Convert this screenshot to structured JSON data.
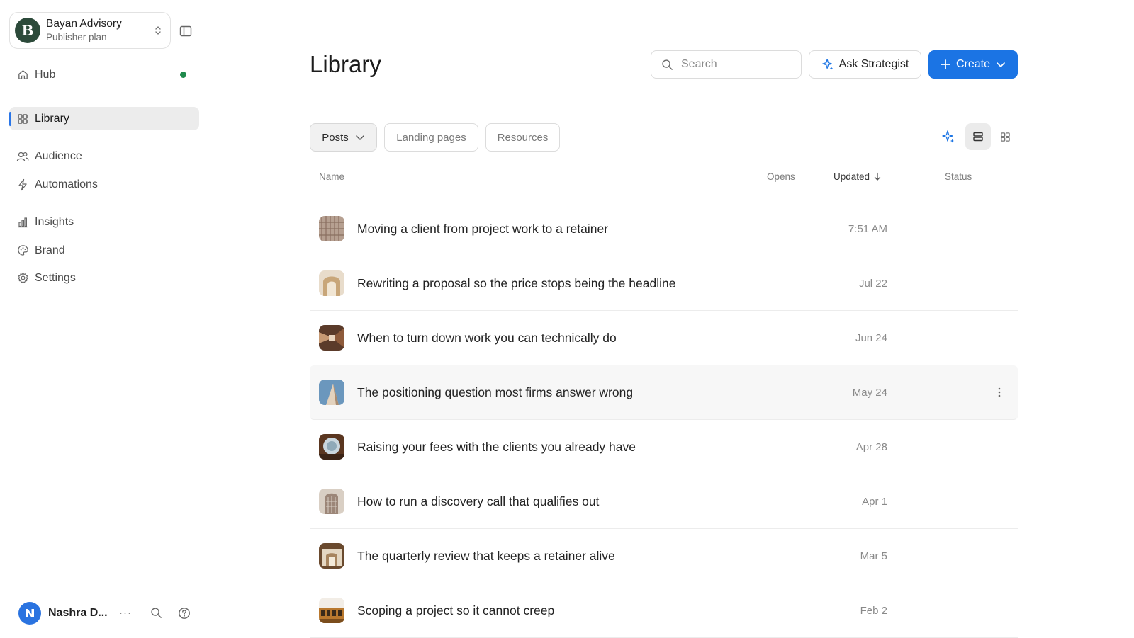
{
  "workspace": {
    "initial": "B",
    "name": "Bayan Advisory",
    "plan": "Publisher plan"
  },
  "nav": {
    "hub": "Hub",
    "library": "Library",
    "audience": "Audience",
    "automations": "Automations",
    "insights": "Insights",
    "brand": "Brand",
    "settings": "Settings"
  },
  "user": {
    "name": "Nashra D...",
    "more": "···"
  },
  "header": {
    "title": "Library",
    "search_placeholder": "Search",
    "ask_label": "Ask Strategist",
    "create_label": "Create"
  },
  "tabs": {
    "posts": "Posts",
    "landing": "Landing pages",
    "resources": "Resources"
  },
  "table": {
    "columns": {
      "name": "Name",
      "opens": "Opens",
      "updated": "Updated",
      "status": "Status"
    },
    "rows": [
      {
        "title": "Moving a client from project work to a retainer",
        "updated": "7:51 AM"
      },
      {
        "title": "Rewriting a proposal so the price stops being the headline",
        "updated": "Jul 22"
      },
      {
        "title": "When to turn down work you can technically do",
        "updated": "Jun 24"
      },
      {
        "title": "The positioning question most firms answer wrong",
        "updated": "May 24"
      },
      {
        "title": "Raising your fees with the clients you already have",
        "updated": "Apr 28"
      },
      {
        "title": "How to run a discovery call that qualifies out",
        "updated": "Apr 1"
      },
      {
        "title": "The quarterly review that keeps a retainer alive",
        "updated": "Mar 5"
      },
      {
        "title": "Scoping a project so it cannot creep",
        "updated": "Feb 2"
      }
    ]
  },
  "colors": {
    "accent": "#1b74e4",
    "status_green": "#1f8a4c",
    "workspace_avatar": "#2c4a3a"
  }
}
